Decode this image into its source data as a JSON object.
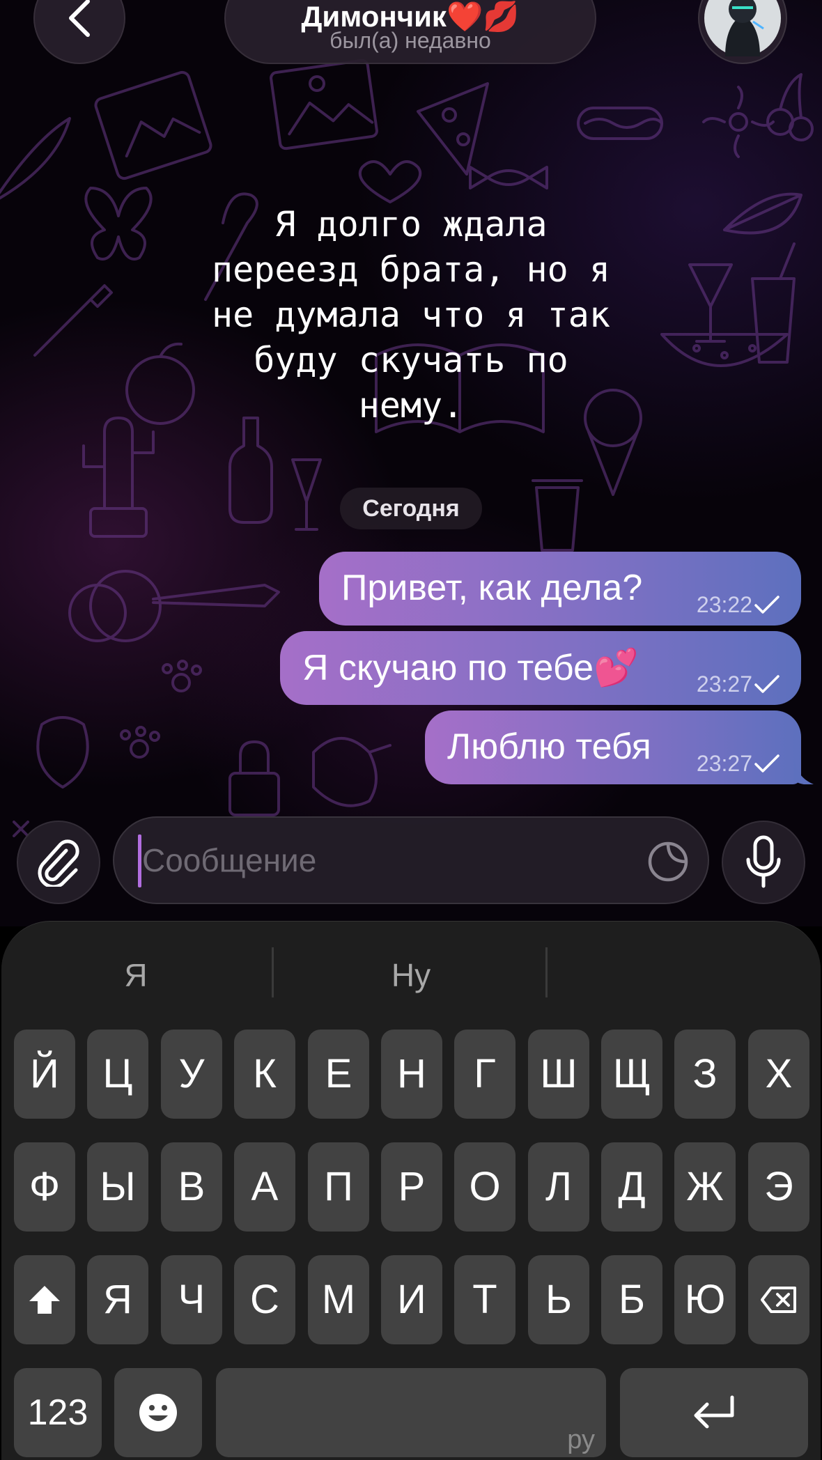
{
  "header": {
    "name": "Димончик❤️💋",
    "status": "был(а) недавно"
  },
  "caption": "Я долго ждала\nпереезд брата, но я\nне думала что я так\nбуду скучать по\nнему.",
  "date_chip": "Сегодня",
  "messages": [
    {
      "text": "Привет, как дела?",
      "time": "23:22"
    },
    {
      "text": "Я скучаю по тебе💕",
      "time": "23:27"
    },
    {
      "text": "Люблю тебя",
      "time": "23:27"
    }
  ],
  "composer": {
    "placeholder": "Сообщение"
  },
  "keyboard": {
    "suggestions": [
      "Я",
      "Ну",
      ""
    ],
    "row1": [
      "Й",
      "Ц",
      "У",
      "К",
      "Е",
      "Н",
      "Г",
      "Ш",
      "Щ",
      "З",
      "Х"
    ],
    "row2": [
      "Ф",
      "Ы",
      "В",
      "А",
      "П",
      "Р",
      "О",
      "Л",
      "Д",
      "Ж",
      "Э"
    ],
    "row3": [
      "Я",
      "Ч",
      "С",
      "М",
      "И",
      "Т",
      "Ь",
      "Б",
      "Ю"
    ],
    "numbers_label": "123",
    "space_lang": "ру"
  },
  "icons": {
    "back": "chevron-left-icon",
    "attach": "paperclip-icon",
    "sticker": "sticker-icon",
    "mic": "microphone-icon",
    "shift": "shift-icon",
    "backspace": "backspace-icon",
    "emoji": "emoji-icon",
    "return": "return-icon",
    "read": "check-icon"
  },
  "colors": {
    "bubble_start": "#a56fc8",
    "bubble_end": "#5d70be",
    "caret": "#b26ee0",
    "keyboard_bg": "#1e1e1e",
    "key_bg": "#424242"
  }
}
